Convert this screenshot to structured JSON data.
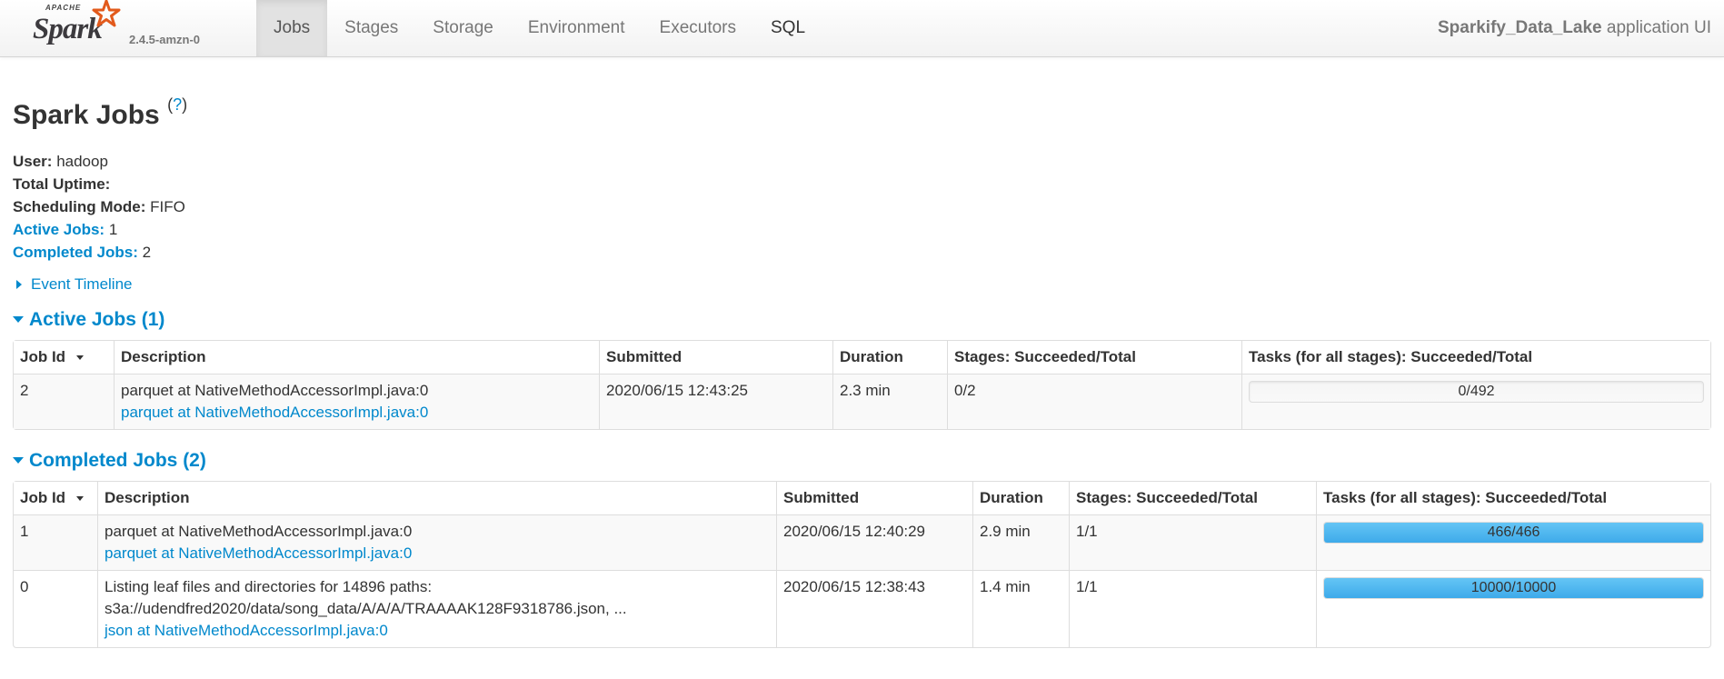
{
  "navbar": {
    "logo_apache": "APACHE",
    "logo_spark": "Spark",
    "version": "2.4.5-amzn-0",
    "tabs": [
      {
        "label": "Jobs",
        "active": true
      },
      {
        "label": "Stages"
      },
      {
        "label": "Storage"
      },
      {
        "label": "Environment"
      },
      {
        "label": "Executors"
      },
      {
        "label": "SQL"
      }
    ],
    "app_name": "Sparkify_Data_Lake",
    "app_suffix": " application UI"
  },
  "page": {
    "title": "Spark Jobs",
    "help": "?"
  },
  "summary": {
    "user_label": "User:",
    "user_value": " hadoop",
    "uptime_label": "Total Uptime:",
    "uptime_value": "",
    "mode_label": "Scheduling Mode:",
    "mode_value": " FIFO",
    "active_label": "Active Jobs:",
    "active_value": " 1",
    "completed_label": "Completed Jobs:",
    "completed_value": " 2"
  },
  "event_timeline": "Event Timeline",
  "columns": {
    "job_id": "Job Id",
    "description": "Description",
    "submitted": "Submitted",
    "duration": "Duration",
    "stages": "Stages: Succeeded/Total",
    "tasks": "Tasks (for all stages): Succeeded/Total"
  },
  "active_jobs": {
    "heading": "Active Jobs (1)",
    "rows": [
      {
        "id": "2",
        "desc": "parquet at NativeMethodAccessorImpl.java:0",
        "desc_link": "parquet at NativeMethodAccessorImpl.java:0",
        "submitted": "2020/06/15 12:43:25",
        "duration": "2.3 min",
        "stages": "0/2",
        "tasks": "0/492",
        "tasks_fraction": 0
      }
    ]
  },
  "completed_jobs": {
    "heading": "Completed Jobs (2)",
    "rows": [
      {
        "id": "1",
        "desc": "parquet at NativeMethodAccessorImpl.java:0",
        "desc_link": "parquet at NativeMethodAccessorImpl.java:0",
        "submitted": "2020/06/15 12:40:29",
        "duration": "2.9 min",
        "stages": "1/1",
        "tasks": "466/466",
        "tasks_fraction": 1
      },
      {
        "id": "0",
        "desc": "Listing leaf files and directories for 14896 paths:",
        "desc_line2": "s3a://udendfred2020/data/song_data/A/A/A/TRAAAAK128F9318786.json, ...",
        "desc_link": "json at NativeMethodAccessorImpl.java:0",
        "submitted": "2020/06/15 12:38:43",
        "duration": "1.4 min",
        "stages": "1/1",
        "tasks": "10000/10000",
        "tasks_fraction": 1
      }
    ]
  },
  "colors": {
    "link": "#0088cc",
    "progress_bar": "#3eaaea"
  }
}
